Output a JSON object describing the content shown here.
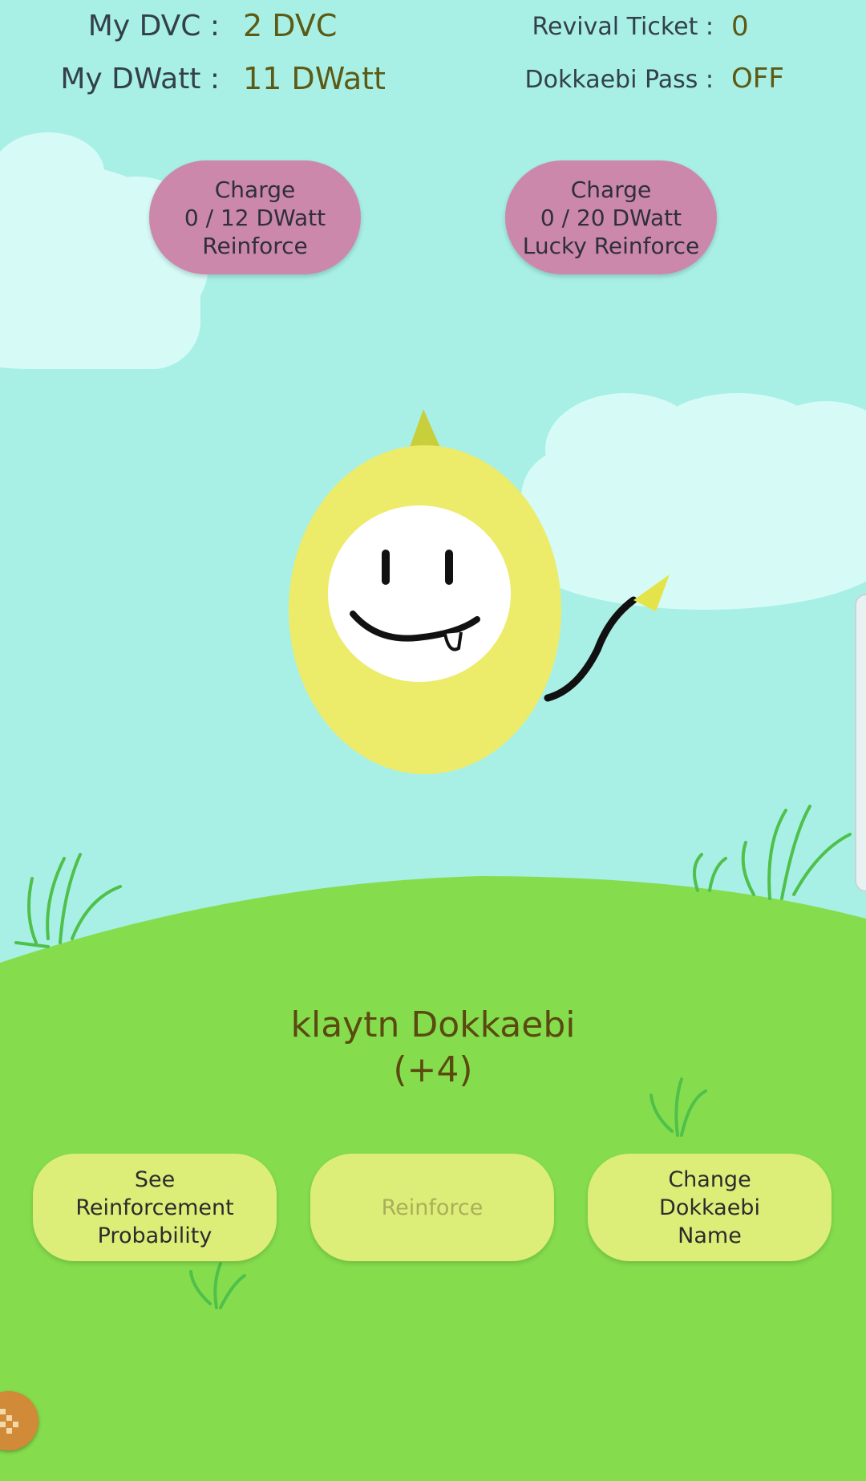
{
  "stats": {
    "dvc_label": "My DVC :",
    "dvc_value": "2 DVC",
    "dwatt_label": "My DWatt :",
    "dwatt_value": "11 DWatt",
    "revival_label": "Revival Ticket :",
    "revival_value": "0",
    "pass_label": "Dokkaebi Pass :",
    "pass_value": "OFF"
  },
  "charge_buttons": [
    {
      "line1": "Charge",
      "line2": "0 / 12 DWatt",
      "line3": "Reinforce"
    },
    {
      "line1": "Charge",
      "line2": "0 / 20 DWatt",
      "line3": "Lucky Reinforce"
    }
  ],
  "character": {
    "name": "klaytn Dokkaebi",
    "level": "(+4)"
  },
  "actions": {
    "probability": [
      "See",
      "Reinforcement",
      "Probability"
    ],
    "reinforce": "Reinforce",
    "rename": [
      "Change",
      "Dokkaebi",
      "Name"
    ]
  },
  "colors": {
    "sky": "#a8f0e6",
    "grass": "#85dd4d",
    "charge_button": "#cc88aa",
    "action_button": "#dcee78"
  }
}
